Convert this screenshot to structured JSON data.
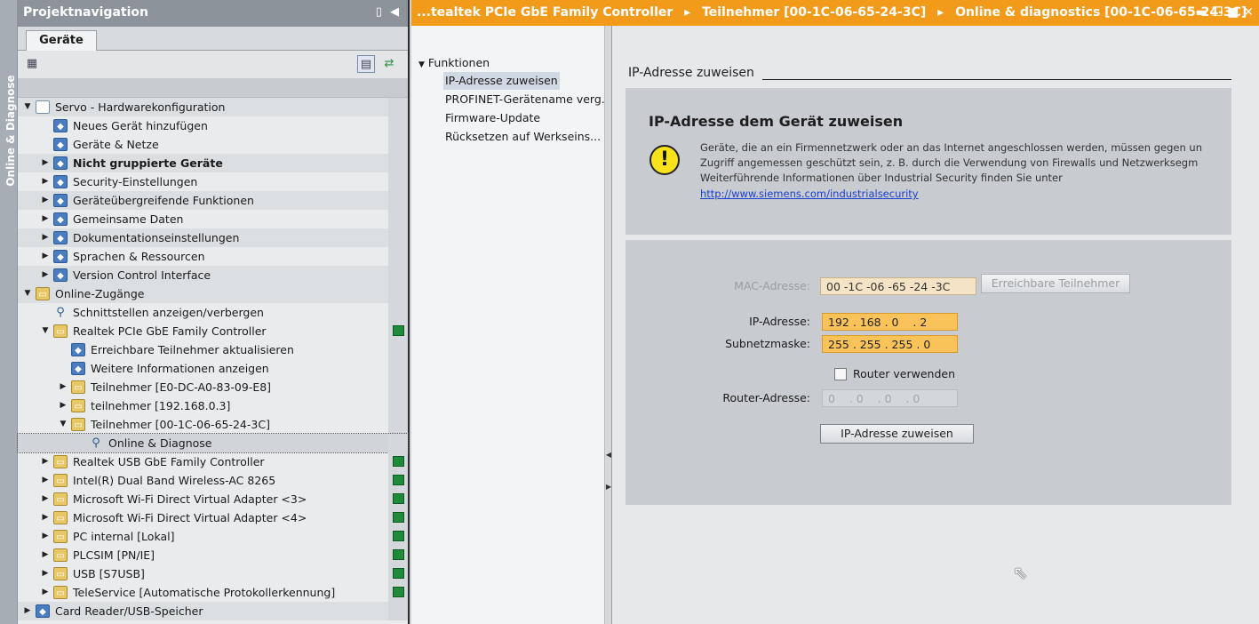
{
  "side_strip": {
    "label": "Online & Diagnose"
  },
  "project_nav": {
    "title": "Projektnavigation",
    "tab": "Geräte",
    "tree": [
      {
        "level": 0,
        "expander": "▼",
        "icon": "doc",
        "label": "Servo - Hardwarekonfiguration",
        "shade": true
      },
      {
        "level": 1,
        "expander": "",
        "icon": "blueico",
        "label": "Neues Gerät hinzufügen"
      },
      {
        "level": 1,
        "expander": "",
        "icon": "blueico",
        "label": "Geräte & Netze"
      },
      {
        "level": 1,
        "expander": "▶",
        "icon": "blueico",
        "label": "Nicht gruppierte Geräte",
        "bold": true,
        "shade": true
      },
      {
        "level": 1,
        "expander": "▶",
        "icon": "blueico",
        "label": "Security-Einstellungen"
      },
      {
        "level": 1,
        "expander": "▶",
        "icon": "blueico",
        "label": "Geräteübergreifende Funktionen",
        "shade": true
      },
      {
        "level": 1,
        "expander": "▶",
        "icon": "blueico",
        "label": "Gemeinsame Daten"
      },
      {
        "level": 1,
        "expander": "▶",
        "icon": "blueico",
        "label": "Dokumentationseinstellungen",
        "shade": true
      },
      {
        "level": 1,
        "expander": "▶",
        "icon": "blueico",
        "label": "Sprachen & Ressourcen"
      },
      {
        "level": 1,
        "expander": "▶",
        "icon": "blueico",
        "label": "Version Control Interface",
        "shade": true
      },
      {
        "level": 0,
        "expander": "▼",
        "icon": "folder",
        "label": "Online-Zugänge",
        "shade": true
      },
      {
        "level": 1,
        "expander": "",
        "icon": "wrench",
        "label": "Schnittstellen anzeigen/verbergen"
      },
      {
        "level": 1,
        "expander": "▼",
        "icon": "folder",
        "label": "Realtek PCIe GbE Family Controller",
        "status": true
      },
      {
        "level": 2,
        "expander": "",
        "icon": "blueico",
        "label": "Erreichbare Teilnehmer aktualisieren"
      },
      {
        "level": 2,
        "expander": "",
        "icon": "blueico",
        "label": "Weitere Informationen anzeigen"
      },
      {
        "level": 2,
        "expander": "▶",
        "icon": "folder",
        "label": "Teilnehmer [E0-DC-A0-83-09-E8]"
      },
      {
        "level": 2,
        "expander": "▶",
        "icon": "folder",
        "label": "teilnehmer [192.168.0.3]"
      },
      {
        "level": 2,
        "expander": "▼",
        "icon": "folder",
        "label": "Teilnehmer [00-1C-06-65-24-3C]"
      },
      {
        "level": 3,
        "expander": "",
        "icon": "wrench",
        "label": "Online & Diagnose",
        "selected": true
      },
      {
        "level": 1,
        "expander": "▶",
        "icon": "folder",
        "label": "Realtek USB GbE Family Controller",
        "status": true
      },
      {
        "level": 1,
        "expander": "▶",
        "icon": "folder",
        "label": "Intel(R) Dual Band Wireless-AC 8265",
        "status": true
      },
      {
        "level": 1,
        "expander": "▶",
        "icon": "folder",
        "label": "Microsoft Wi-Fi Direct Virtual Adapter <3>",
        "status": true
      },
      {
        "level": 1,
        "expander": "▶",
        "icon": "folder",
        "label": "Microsoft Wi-Fi Direct Virtual Adapter <4>",
        "status": true
      },
      {
        "level": 1,
        "expander": "▶",
        "icon": "folder",
        "label": "PC internal [Lokal]",
        "status": true
      },
      {
        "level": 1,
        "expander": "▶",
        "icon": "folder",
        "label": "PLCSIM [PN/IE]",
        "status": true
      },
      {
        "level": 1,
        "expander": "▶",
        "icon": "folder",
        "label": "USB [S7USB]",
        "status": true
      },
      {
        "level": 1,
        "expander": "▶",
        "icon": "folder",
        "label": "TeleService [Automatische Protokollerkennung]",
        "status": true
      },
      {
        "level": 0,
        "expander": "▶",
        "icon": "blueico",
        "label": "Card Reader/USB-Speicher",
        "shade": true
      }
    ]
  },
  "breadcrumb": {
    "items": [
      "...tealtek PCIe GbE Family Controller",
      "Teilnehmer [00-1C-06-65-24-3C]",
      "Online & diagnostics [00-1C-06-65-24-3C]"
    ],
    "separator": "▸"
  },
  "functions": {
    "header": "Funktionen",
    "items": [
      "IP-Adresse zuweisen",
      "PROFINET-Gerätename verg...",
      "Firmware-Update",
      "Rücksetzen auf Werkseins..."
    ]
  },
  "content": {
    "section_title": "IP-Adresse zuweisen",
    "info": {
      "title": "IP-Adresse dem Gerät zuweisen",
      "lines": [
        "Geräte, die an ein Firmennetzwerk oder an das Internet angeschlossen werden, müssen gegen un",
        "Zugriff angemessen geschützt sein, z. B. durch die Verwendung von Firewalls und Netzwerksegm",
        "Weiterführende Informationen über Industrial Security finden Sie unter"
      ],
      "link": "http://www.siemens.com/industrialsecurity"
    },
    "form": {
      "mac_label": "MAC-Adresse:",
      "mac_value": "00 -1C -06 -65 -24 -3C",
      "reachable_button": "Erreichbare Teilnehmer",
      "ip_label": "IP-Adresse:",
      "ip_value": "192 . 168 . 0    . 2",
      "subnet_label": "Subnetzmaske:",
      "subnet_value": "255 . 255 . 255 . 0",
      "router_checkbox": "Router verwenden",
      "router_label": "Router-Adresse:",
      "router_value": "0    . 0    . 0    . 0",
      "assign_button": "IP-Adresse zuweisen"
    }
  }
}
